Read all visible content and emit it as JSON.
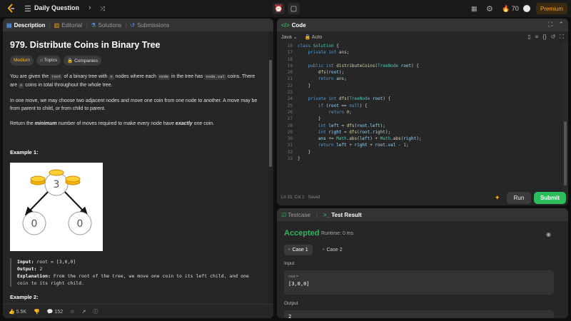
{
  "topbar": {
    "title": "Daily Question",
    "streak": "70",
    "premium": "Premium"
  },
  "left_tabs": [
    {
      "label": "Description",
      "icon": "document-icon"
    },
    {
      "label": "Editorial",
      "icon": "book-icon"
    },
    {
      "label": "Solutions",
      "icon": "flask-icon"
    },
    {
      "label": "Submissions",
      "icon": "history-icon"
    }
  ],
  "problem": {
    "title": "979. Distribute Coins in Binary Tree",
    "difficulty": "Medium",
    "topics": "Topics",
    "companies": "Companies",
    "p1_a": "You are given the ",
    "p1_root": "root",
    "p1_b": " of a binary tree with ",
    "p1_n": "n",
    "p1_c": " nodes where each ",
    "p1_node": "node",
    "p1_d": " in the tree has ",
    "p1_nodeval": "node.val",
    "p1_e": " coins. There are ",
    "p1_n2": "n",
    "p1_f": " coins in total throughout the whole tree.",
    "p2": "In one move, we may choose two adjacent nodes and move one coin from one node to another. A move may be from parent to child, or from child to parent.",
    "p3_a": "Return the ",
    "p3_min": "minimum",
    "p3_b": " number of moves required to make every node have ",
    "p3_exactly": "exactly",
    "p3_c": " one coin.",
    "ex1_head": "Example 1:",
    "ex1_root_val": "3",
    "ex1_left_val": "0",
    "ex1_right_val": "0",
    "ex1_input_label": "Input:",
    "ex1_input": " root = [3,0,0]",
    "ex1_output_label": "Output:",
    "ex1_output": " 2",
    "ex1_expl_label": "Explanation:",
    "ex1_expl": " From the root of the tree, we move one coin to its left child, and one coin to its right child.",
    "ex2_head": "Example 2:"
  },
  "footer": {
    "likes": "5.5K",
    "comments": "152"
  },
  "code_panel": {
    "title": "Code",
    "language": "Java",
    "mode": "Auto",
    "status": "Ln 33, Col 2",
    "saved": "Saved",
    "run": "Run",
    "submit": "Submit"
  },
  "code_lines": [
    {
      "n": "16",
      "t": "class Solution {"
    },
    {
      "n": "17",
      "t": "    private int ans;"
    },
    {
      "n": "18",
      "t": ""
    },
    {
      "n": "19",
      "t": "    public int distributeCoins(TreeNode root) {"
    },
    {
      "n": "20",
      "t": "        dfs(root);"
    },
    {
      "n": "21",
      "t": "        return ans;"
    },
    {
      "n": "22",
      "t": "    }"
    },
    {
      "n": "23",
      "t": ""
    },
    {
      "n": "24",
      "t": "    private int dfs(TreeNode root) {"
    },
    {
      "n": "25",
      "t": "        if (root == null) {"
    },
    {
      "n": "26",
      "t": "            return 0;"
    },
    {
      "n": "27",
      "t": "        }"
    },
    {
      "n": "28",
      "t": "        int left = dfs(root.left);"
    },
    {
      "n": "29",
      "t": "        int right = dfs(root.right);"
    },
    {
      "n": "30",
      "t": "        ans += Math.abs(left) + Math.abs(right);"
    },
    {
      "n": "31",
      "t": "        return left + right + root.val - 1;"
    },
    {
      "n": "32",
      "t": "    }"
    },
    {
      "n": "33",
      "t": "}"
    }
  ],
  "test_panel": {
    "tab1": "Testcase",
    "tab2": "Test Result",
    "result": "Accepted",
    "runtime": "Runtime: 0 ms",
    "case1": "Case 1",
    "case2": "Case 2",
    "input_label": "Input",
    "input_name": "root =",
    "input_value": "[3,0,0]",
    "output_label": "Output",
    "output_value": "2"
  },
  "colors": {
    "accepted": "#2db55d",
    "medium": "#ffb800",
    "premium": "#ffa116"
  }
}
